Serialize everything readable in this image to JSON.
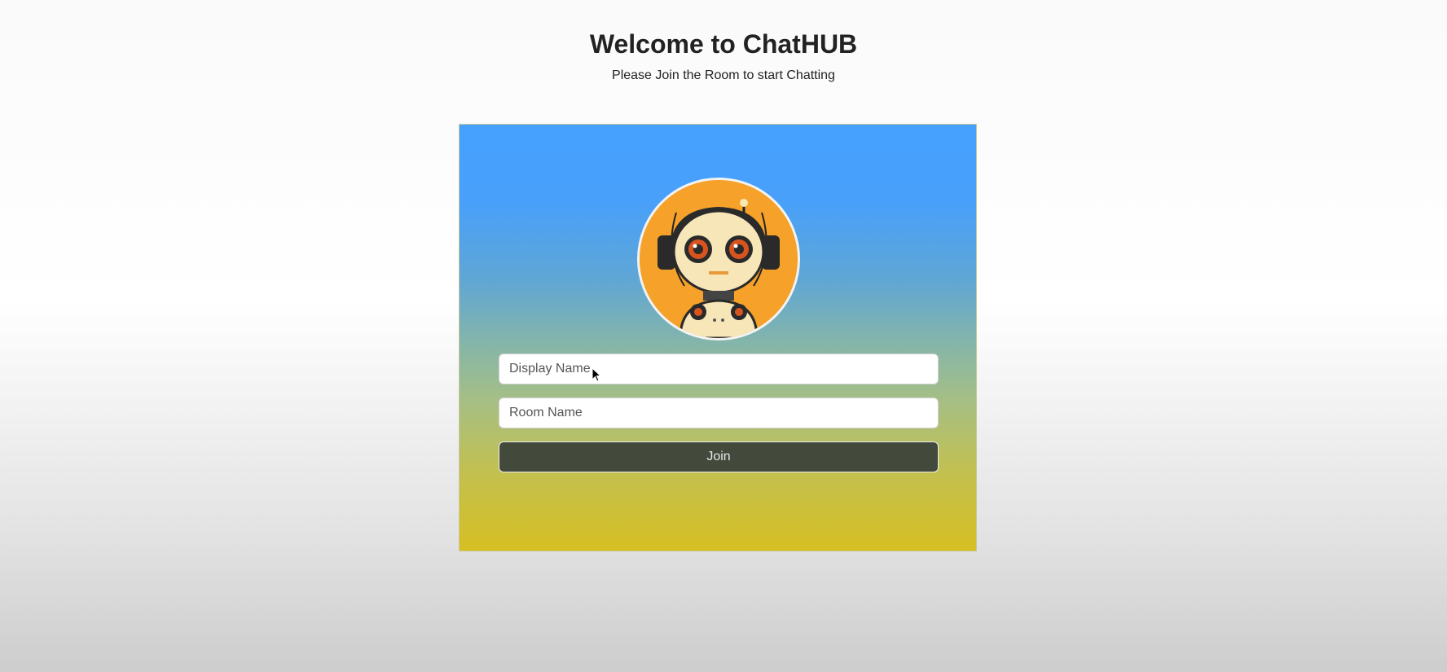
{
  "header": {
    "title": "Welcome to ChatHUB",
    "subtitle": "Please Join the Room to start Chatting"
  },
  "form": {
    "avatar_icon": "robot-avatar",
    "display_name_placeholder": "Display Name",
    "display_name_value": "",
    "room_name_placeholder": "Room Name",
    "room_name_value": "",
    "join_label": "Join"
  },
  "colors": {
    "card_top": "#45a0fe",
    "card_bottom": "#d6bf22",
    "join_button": "#434a3c",
    "avatar_bg": "#f5a12a"
  }
}
